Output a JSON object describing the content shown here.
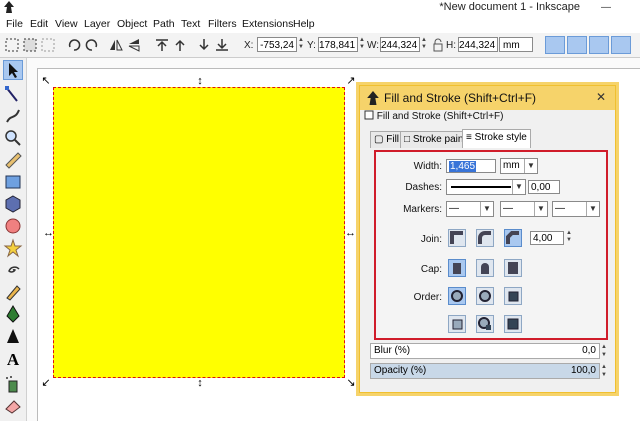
{
  "window": {
    "title": "*New document 1 - Inkscape",
    "controls": [
      "minimize-icon",
      "maximize-icon",
      "close-icon"
    ]
  },
  "menu": [
    "File",
    "Edit",
    "View",
    "Layer",
    "Object",
    "Path",
    "Text",
    "Filters",
    "Extensions",
    "Help"
  ],
  "toolbar": {
    "x_label": "X:",
    "x_value": "-753,24",
    "y_label": "Y:",
    "y_value": "178,841",
    "w_label": "W:",
    "w_value": "244,324",
    "h_label": "H:",
    "h_value": "244,324",
    "unit": "mm"
  },
  "colors": {
    "fill": "#ffff00",
    "stroke": "#dd1111",
    "dialog_title": "#f6d36a",
    "highlight_box": "#d01c2a"
  },
  "dialog": {
    "title": "Fill and Stroke (Shift+Ctrl+F)",
    "panel_header": "Fill and Stroke (Shift+Ctrl+F)",
    "tabs": [
      "Fill",
      "Stroke paint",
      "Stroke style"
    ],
    "active_tab": "Stroke style",
    "width_label": "Width:",
    "width_value": "1,465",
    "width_unit": "mm",
    "dashes_label": "Dashes:",
    "dashes_value": "0,00",
    "markers_label": "Markers:",
    "marker_values": [
      "—",
      "—",
      "—"
    ],
    "join_label": "Join:",
    "miter_value": "4,00",
    "cap_label": "Cap:",
    "order_label": "Order:",
    "blur_label": "Blur (%)",
    "blur_value": "0,0",
    "opacity_label": "Opacity (%)",
    "opacity_value": "100,0"
  }
}
